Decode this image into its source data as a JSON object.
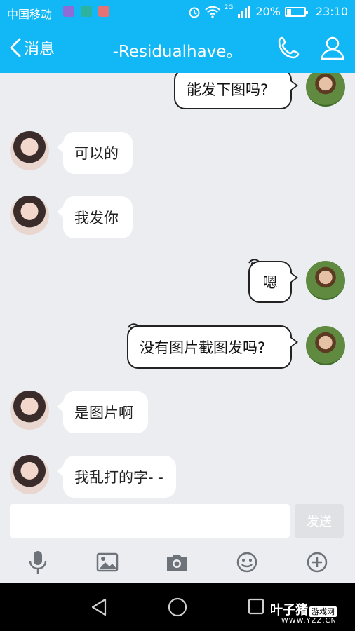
{
  "status_bar": {
    "carrier": "中国移动",
    "network": "2G",
    "battery": "20%",
    "time": "23:10"
  },
  "header": {
    "back_label": "消息",
    "title": "-Residualhave。"
  },
  "messages": [
    {
      "side": "right",
      "text": "能发下图吗?"
    },
    {
      "side": "left",
      "text": "可以的"
    },
    {
      "side": "left",
      "text": "我发你"
    },
    {
      "side": "right",
      "text": "嗯"
    },
    {
      "side": "right",
      "text": "没有图片截图发吗?"
    },
    {
      "side": "left",
      "text": "是图片啊"
    },
    {
      "side": "left",
      "text": "我乱打的字- -"
    }
  ],
  "input": {
    "value": "",
    "send_label": "发送"
  },
  "toolbar": {
    "icons": [
      "microphone-icon",
      "image-icon",
      "camera-icon",
      "emoji-icon",
      "plus-icon"
    ]
  },
  "watermark": {
    "brand": "叶子猪",
    "tag": "游戏网",
    "url": "WWW.YZZ.CN"
  },
  "colors": {
    "header": "#12b7f5",
    "background": "#ebedf1"
  }
}
